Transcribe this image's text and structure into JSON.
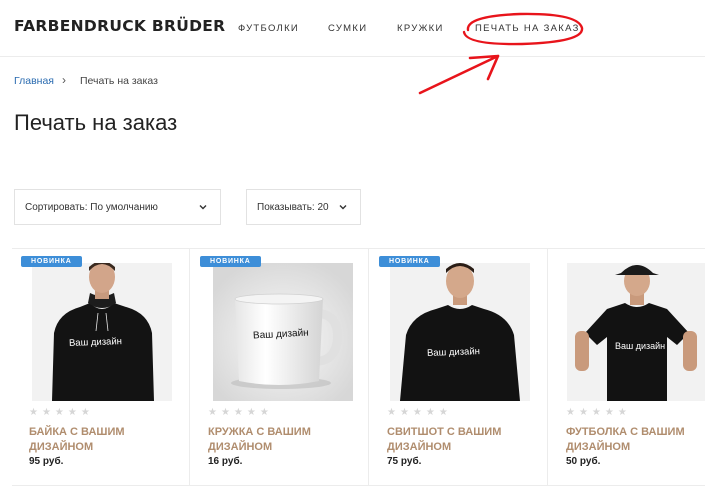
{
  "header": {
    "logo": "FARBENDRUCK BRÜDER",
    "nav": [
      {
        "label": "футболки"
      },
      {
        "label": "сумки"
      },
      {
        "label": "кружки"
      },
      {
        "label": "печать на заказ"
      }
    ]
  },
  "breadcrumb": {
    "home": "Главная",
    "separator": "›",
    "current": "Печать на заказ"
  },
  "page": {
    "title": "Печать на заказ"
  },
  "filters": {
    "sort_label": "Сортировать: По умолчанию",
    "show_label": "Показывать: 20"
  },
  "products": [
    {
      "badge": "НОВИНКА",
      "design_text": "Ваш дизайн",
      "name": "БАЙКА С ВАШИМ ДИЗАЙНОМ",
      "price": "95 руб.",
      "rating": 0,
      "stars": "★★★★★"
    },
    {
      "badge": "НОВИНКА",
      "design_text": "Ваш дизайн",
      "name": "КРУЖКА С ВАШИМ ДИЗАЙНОМ",
      "price": "16 руб.",
      "rating": 0,
      "stars": "★★★★★"
    },
    {
      "badge": "НОВИНКА",
      "design_text": "Ваш дизайн",
      "name": "СВИТШОТ С ВАШИМ ДИЗАЙНОМ",
      "price": "75 руб.",
      "rating": 0,
      "stars": "★★★★★"
    },
    {
      "badge": "",
      "design_text": "Ваш дизайн",
      "name": "ФУТБОЛКА С ВАШИМ ДИЗАЙНОМ",
      "price": "50 руб.",
      "rating": 0,
      "stars": "★★★★★"
    }
  ],
  "colors": {
    "accent_badge": "#3d8ed8",
    "product_name": "#b08d6e",
    "annotation": "#e8141b",
    "link": "#2a6bb0"
  }
}
